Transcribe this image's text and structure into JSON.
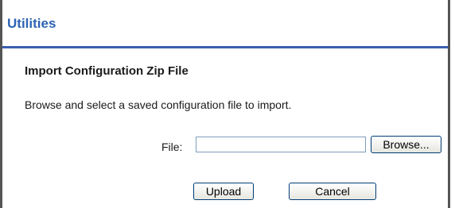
{
  "header": {
    "title": "Utilities",
    "accent_color": "#2d64b4",
    "rule_color": "#3b5fb0"
  },
  "section": {
    "title": "Import Configuration Zip File",
    "description": "Browse and select a saved configuration file to import."
  },
  "file_field": {
    "label": "File:",
    "value": "",
    "placeholder": ""
  },
  "buttons": {
    "browse_label": "Browse...",
    "upload_label": "Upload",
    "cancel_label": "Cancel"
  }
}
